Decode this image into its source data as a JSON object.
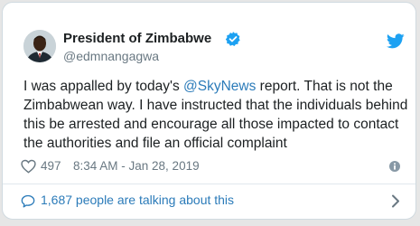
{
  "tweet": {
    "author": {
      "name": "President of Zimbabwe",
      "handle": "@edmnangagwa",
      "verified": true
    },
    "text": {
      "before_mention": "I was appalled by today's ",
      "mention": "@SkyNews",
      "after_mention": " report. That is not the Zimbabwean way. I have instructed that the individuals behind this be arrested and encourage all those impacted to contact the authorities and file an official complaint"
    },
    "likes": "497",
    "timestamp": "8:34 AM - Jan 28, 2019",
    "conversation_label": "1,687 people are talking about this"
  },
  "icons": {
    "avatar": "avatar-photo",
    "verified": "verified-badge-icon",
    "brand": "twitter-bird-icon",
    "like": "heart-icon",
    "info": "info-icon",
    "reply": "reply-bubble-icon",
    "more": "chevron-right-icon"
  },
  "colors": {
    "accent": "#1da1f2",
    "link": "#2b7bb9",
    "text": "#1c2022",
    "muted": "#697882",
    "border": "#e1e8ed",
    "background": "#e6e6e6"
  }
}
